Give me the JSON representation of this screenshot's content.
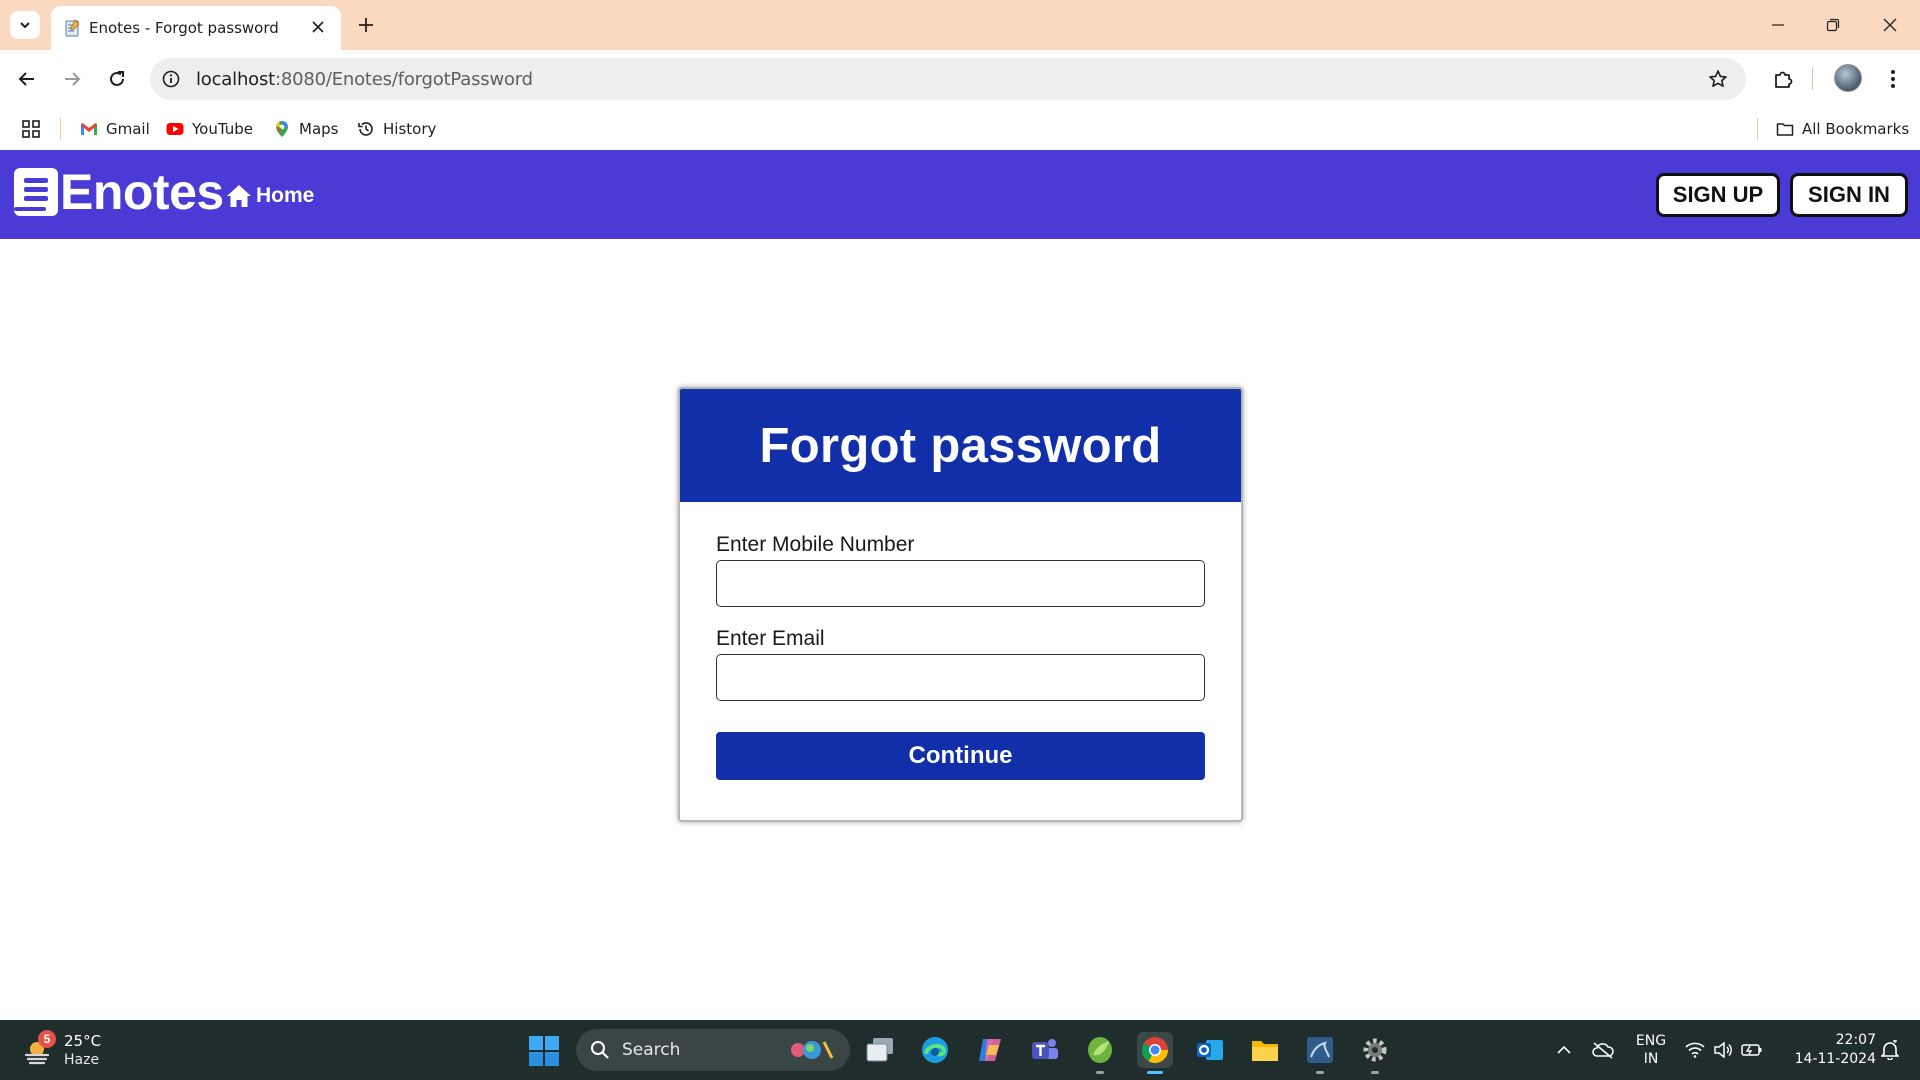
{
  "browser": {
    "tab_title": "Enotes - Forgot password",
    "url_host": "localhost",
    "url_path": ":8080/Enotes/forgotPassword",
    "bookmarks": [
      {
        "label": "Gmail",
        "icon": "gmail-icon"
      },
      {
        "label": "YouTube",
        "icon": "youtube-icon"
      },
      {
        "label": "Maps",
        "icon": "maps-icon"
      },
      {
        "label": "History",
        "icon": "history-icon"
      }
    ],
    "all_bookmarks": "All Bookmarks",
    "tab_strip_color": "#fbd8c0"
  },
  "navbar": {
    "brand": "Enotes",
    "home": "Home",
    "signup": "SIGN UP",
    "signin": "SIGN IN",
    "color": "#4a3bd6"
  },
  "form": {
    "title": "Forgot password",
    "mobile_label": "Enter Mobile Number",
    "mobile_value": "",
    "email_label": "Enter Email",
    "email_value": "",
    "submit": "Continue",
    "header_color": "#112fa8"
  },
  "taskbar": {
    "weather_badge": "5",
    "temperature": "25°C",
    "condition": "Haze",
    "search": "Search",
    "lang_top": "ENG",
    "lang_bottom": "IN",
    "time": "22:07",
    "date": "14-11-2024",
    "apps": [
      "file-explorer-icon",
      "edge-icon",
      "copilot-icon",
      "teams-icon",
      "spring-icon",
      "chrome-icon",
      "outlook-icon",
      "folder-icon",
      "mysql-icon",
      "settings-icon"
    ]
  }
}
